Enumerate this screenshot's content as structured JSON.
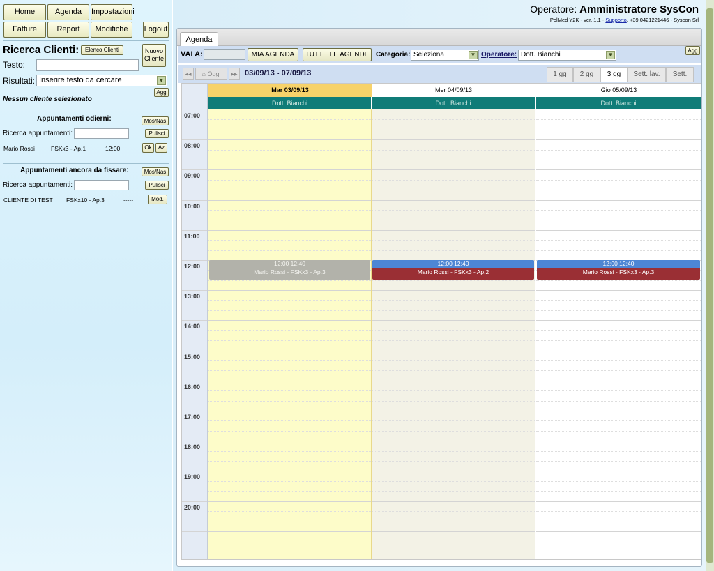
{
  "nav": {
    "home": "Home",
    "agenda": "Agenda",
    "impostazioni": "Impostazioni",
    "fatture": "Fatture",
    "report": "Report",
    "modifiche": "Modifiche",
    "logout": "Logout"
  },
  "ricerca": {
    "title": "Ricerca Clienti:",
    "elenco_button": "Elenco Clienti",
    "nuovo_line1": "Nuovo",
    "nuovo_line2": "Cliente",
    "testo_label": "Testo:",
    "testo_value": "",
    "risultati_label": "Risultati:",
    "risultati_value": "Inserire testo da cercare",
    "agg_button": "Agg",
    "none_selected": "Nessun cliente selezionato"
  },
  "appuntamenti_odierni": {
    "title": "Appuntamenti odierni:",
    "mosnas_button": "Mos/Nas",
    "search_label": "Ricerca appuntamenti:",
    "search_value": "",
    "pulisci_button": "Pulisci",
    "items": [
      {
        "name": "Mario Rossi",
        "code": "FSKx3 - Ap.1",
        "time": "12:00",
        "ok": "Ok",
        "az": "Az"
      }
    ]
  },
  "appuntamenti_da_fissare": {
    "title": "Appuntamenti ancora da fissare:",
    "mosnas_button": "Mos/Nas",
    "search_label": "Ricerca appuntamenti:",
    "search_value": "",
    "pulisci_button": "Pulisci",
    "items": [
      {
        "name": "CLIENTE DI TEST",
        "code": "FSKx10 - Ap.3",
        "time": "-----",
        "mod": "Mod."
      }
    ]
  },
  "header": {
    "operatore_label": "Operatore:",
    "operatore_name": "Amministratore SysCon",
    "version_prefix": "PolMed Y2K - ver. 1.1 - ",
    "supporto_link": "Supporto",
    "version_suffix": ", +39.0421221446 - Syscon Srl"
  },
  "agenda": {
    "tab_label": "Agenda",
    "vai_a_label": "VAI A:",
    "vai_a_value": "",
    "mia_agenda": "MIA AGENDA",
    "tutte_agende": "TUTTE LE AGENDE",
    "categoria_label": "Categoria:",
    "categoria_value": "Seleziona",
    "operatore_label": "Operatore:",
    "operatore_value": "Dott. Bianchi",
    "agg_button": "Agg",
    "prev_arrow": "◂◂",
    "oggi": "Oggi",
    "next_arrow": "▸▸",
    "date_range": "03/09/13 - 07/09/13",
    "views": [
      "1 gg",
      "2 gg",
      "3 gg",
      "Sett. lav.",
      "Sett."
    ],
    "active_view": "3 gg",
    "days": [
      {
        "label": "Mar 03/09/13",
        "operator": "Dott. Bianchi",
        "bg": "#fdfcc9",
        "head_bg": "#f7d26a"
      },
      {
        "label": "Mer 04/09/13",
        "operator": "Dott. Bianchi",
        "bg": "#f3f2e6",
        "head_bg": "#ffffff"
      },
      {
        "label": "Gio 05/09/13",
        "operator": "Dott. Bianchi",
        "bg": "#ffffff",
        "head_bg": "#ffffff"
      }
    ],
    "hours": [
      "07:00",
      "08:00",
      "09:00",
      "10:00",
      "11:00",
      "12:00",
      "13:00",
      "14:00",
      "15:00",
      "16:00",
      "17:00",
      "18:00",
      "19:00",
      "20:00"
    ],
    "events": [
      {
        "day": 0,
        "time": "12:00 12:40",
        "title": "Mario Rossi - FSKx3 - Ap.3",
        "time_bg": "#b2b2aa",
        "title_bg": "#b2b2aa",
        "text_color": "#f4f4f0"
      },
      {
        "day": 1,
        "time": "12:00 12:40",
        "title": "Mario Rossi - FSKx3 - Ap.2",
        "time_bg": "#4d86d4",
        "title_bg": "#9a2f34",
        "text_color": "#ffffff"
      },
      {
        "day": 2,
        "time": "12:00 12:40",
        "title": "Mario Rossi - FSKx3 - Ap.3",
        "time_bg": "#4d86d4",
        "title_bg": "#9a2f34",
        "text_color": "#ffffff"
      }
    ]
  }
}
